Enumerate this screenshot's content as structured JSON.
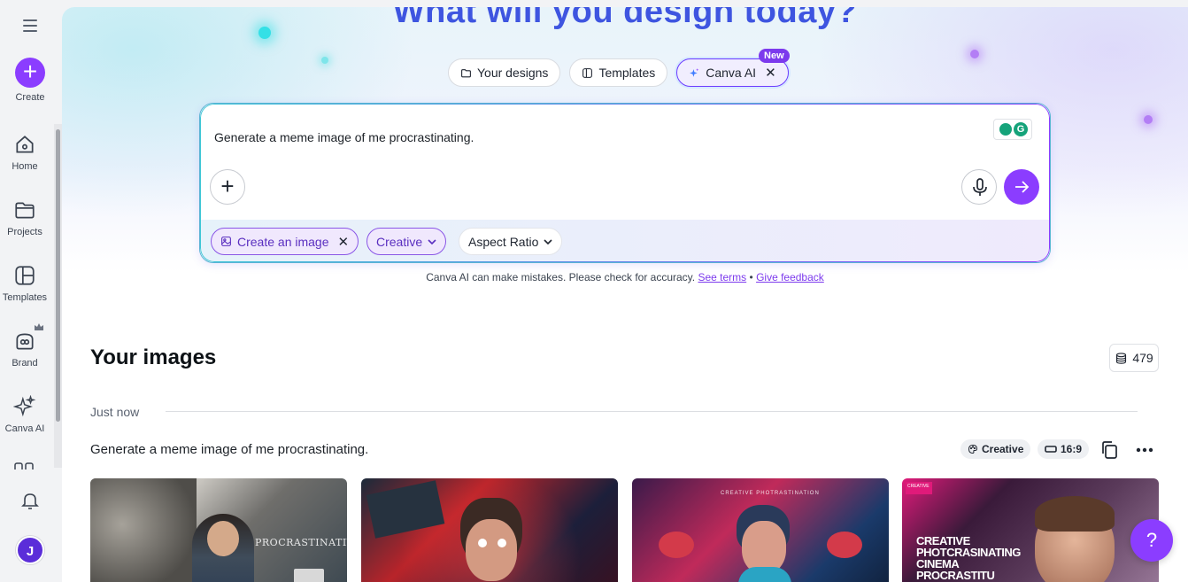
{
  "sidebar": {
    "create_label": "Create",
    "items": [
      {
        "label": "Home",
        "icon": "home-icon"
      },
      {
        "label": "Projects",
        "icon": "folder-icon"
      },
      {
        "label": "Templates",
        "icon": "templates-icon"
      },
      {
        "label": "Brand",
        "icon": "brand-icon"
      },
      {
        "label": "Canva AI",
        "icon": "sparkles-icon"
      }
    ],
    "avatar_initial": "J"
  },
  "hero": {
    "title": "What will you design today?"
  },
  "tabs": [
    {
      "label": "Your designs",
      "icon": "folder-icon"
    },
    {
      "label": "Templates",
      "icon": "templates-icon"
    },
    {
      "label": "Canva AI",
      "icon": "sparkles-icon",
      "badge": "New",
      "active": true
    }
  ],
  "prompt": {
    "text": "Generate a meme image of me procrastinating.",
    "chips": {
      "create": "Create an image",
      "style": "Creative",
      "aspect": "Aspect Ratio"
    }
  },
  "disclaimer": {
    "text": "Canva AI can make mistakes. Please check for accuracy.",
    "see_terms": "See terms",
    "separator": "•",
    "give_feedback": "Give feedback"
  },
  "images_section": {
    "title": "Your images",
    "credits": "479",
    "group_label": "Just now",
    "generation_prompt": "Generate a meme image of me procrastinating.",
    "style_tag": "Creative",
    "ratio_tag": "16:9"
  },
  "thumbnails": [
    {
      "caption": "PROCRASTINATIVE"
    },
    {
      "caption": ""
    },
    {
      "caption": "CREATIVE PHOTRASTINATION"
    },
    {
      "caption_lines": [
        "CREATIVE",
        "PHOTCRASINATING",
        "CINEMA",
        "PROCRASTITU"
      ]
    }
  ],
  "help_label": "?",
  "colors": {
    "accent": "#8b3dff",
    "title_blue": "#3e55e0"
  }
}
